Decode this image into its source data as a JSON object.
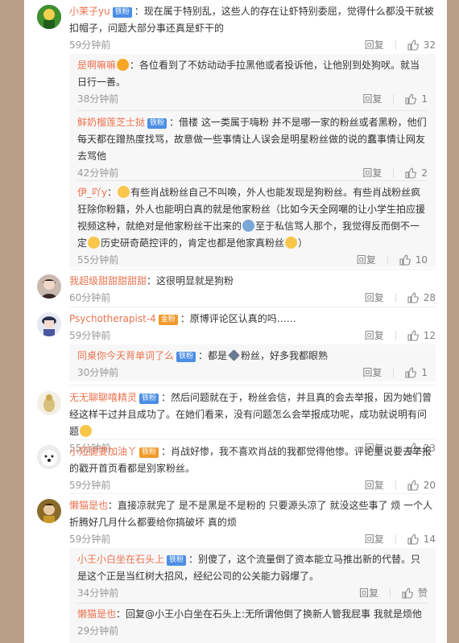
{
  "labels": {
    "reply": "回复",
    "like": "赞"
  },
  "comments": [
    {
      "user": "小茉子yu",
      "badge": "铁粉",
      "text": "：现在属于特别乱，这些人的存在让虾特别委屈，觉得什么都没干就被扣帽子，问题大部分事还真是虾干的",
      "time": "59分钟前",
      "likes": "32",
      "replies": [
        {
          "user": "是啊嘛嘛",
          "text": "：各位看到了不妨动动手拉黑他或者投诉他，让他别到处狗吠。就当日行一善。",
          "time": "38分钟前",
          "likes": "1"
        },
        {
          "user": "鲜奶榴莲芝士挞",
          "badge": "铁粉",
          "text": "：借楼 这一类属于嗨粉 并不是哪一家的粉丝或者黑粉，他们每天都在蹭热度找骂，故意做一些事情让人误会是明星粉丝做的说的蠢事情让网友去骂他",
          "time": "42分钟前",
          "likes": "2"
        },
        {
          "user": "伊_吖y",
          "text_a": "：",
          "text_b": "有些肖战粉丝自己不叫唤，外人也能发现是狗粉丝。有些肖战粉丝疯狂除你粉籍，外人也能明白真的就是他家粉丝（比如今天全网嘲的让小学生拍应援视频这种，就绝对是他家粉丝干出来的",
          "text_c": "至于私信骂人那个，我觉得反而倒不一定",
          "text_d": "历史研奇葩控评的，肯定也都是他家真粉丝",
          "text_e": "）",
          "time": "55分钟前",
          "likes": "10"
        }
      ]
    },
    {
      "user": "我超级甜甜甜甜甜",
      "text": "：这很明显就是狗粉",
      "time": "60分钟前",
      "likes": "28"
    },
    {
      "user": "Psychotherapist-4",
      "badge": "金粉",
      "text": "：原博评论区认真的吗……",
      "time": "59分钟前",
      "likes": "12",
      "replies": [
        {
          "user": "同桌你今天背单词了么",
          "badge": "铁粉",
          "text_a": "：都是",
          "text_b": "粉丝，好多我都眼熟",
          "time": "30分钟前",
          "likes": "1"
        }
      ]
    },
    {
      "user": "无无聊聊嘻精灵",
      "badge": "铁粉",
      "text": "：然后问题就在于，粉丝会信，并且真的会去举报，因为她们曾经这样干过并且成功了。在她们看来，没有问题怎么会举报成功呢，成功就说明有问题",
      "time": "55分钟前",
      "likes": "23"
    },
    {
      "user": "小短腿要加油丫",
      "badge": "铁粉",
      "text": "：肖战好惨，我不喜欢肖战的我都觉得他惨。评论里说要去举报的戳开首页看都是别家粉丝。",
      "time": "59分钟前",
      "likes": "20"
    },
    {
      "user": "懒猫是也",
      "text": "：直接凉就完了 是不是黑是不是粉的 只要源头凉了 就没这些事了 烦 一个人折腾好几月什么都要给你搞破坏 真的烦",
      "time": "59分钟前",
      "likes": "14",
      "replies": [
        {
          "user": "小王小白坐在石头上",
          "badge": "铁粉",
          "text": "：别傻了，这个流量倒了资本能立马推出新的代替。只是这个正是当红树大招风，经纪公司的公关能力弱爆了。",
          "time": "34分钟前"
        },
        {
          "user": "懒猫是也",
          "text": "：回复@小王小白坐在石头上:无所谓他倒了换新人管我屁事 我就是烦他",
          "time": "29分钟前"
        }
      ]
    }
  ],
  "colors": {
    "link": "#eb7350",
    "badge": "#4c8ee5",
    "reply_bg": "#f7f7f7",
    "page_bg": "#b8a088"
  },
  "icons": [
    "thumb-up-icon",
    "vip-crown-icon"
  ]
}
